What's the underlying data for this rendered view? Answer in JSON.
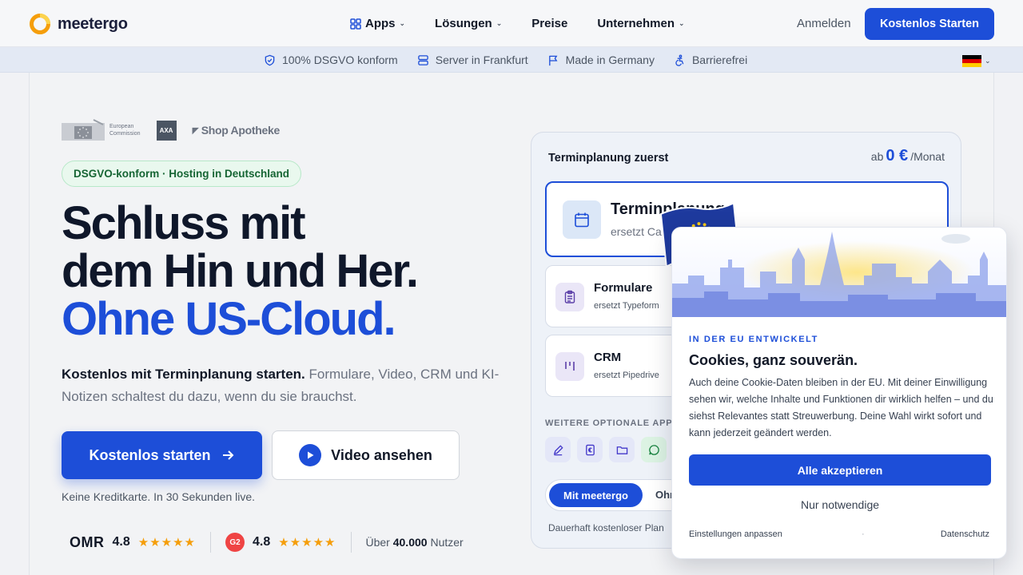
{
  "nav": {
    "logo_text": "meetergo",
    "items": [
      {
        "label": "Apps",
        "has_dropdown": true,
        "icon": "grid-icon"
      },
      {
        "label": "Lösungen",
        "has_dropdown": true
      },
      {
        "label": "Preise",
        "has_dropdown": false
      },
      {
        "label": "Unternehmen",
        "has_dropdown": true
      }
    ],
    "login": "Anmelden",
    "cta": "Kostenlos Starten"
  },
  "trustbar": {
    "items": [
      {
        "label": "100% DSGVO konform",
        "icon": "shield-check-icon"
      },
      {
        "label": "Server in Frankfurt",
        "icon": "server-icon"
      },
      {
        "label": "Made in Germany",
        "icon": "flag-icon"
      },
      {
        "label": "Barrierefrei",
        "icon": "accessibility-icon"
      }
    ],
    "language_flag": "german-flag-icon"
  },
  "hero": {
    "logos": {
      "european_commission_line1": "European",
      "european_commission_line2": "Commission",
      "axa": "AXA",
      "shop_apotheke": "Shop Apotheke"
    },
    "pill": "DSGVO-konform · Hosting in Deutschland",
    "headline_line1": "Schluss mit",
    "headline_line2": "dem Hin und Her.",
    "headline_line3": "Ohne US-Cloud.",
    "lead_bold": "Kostenlos mit Terminplanung starten.",
    "lead_rest": " Formulare, Video, CRM und KI-Notizen schaltest du dazu, wenn du sie brauchst.",
    "primary_button": "Kostenlos starten",
    "secondary_button": "Video ansehen",
    "note": "Keine Kreditkarte. In 30 Sekunden live.",
    "ratings": {
      "omr_label": "OMR",
      "omr_score": "4.8",
      "g2_label": "G2",
      "g2_score": "4.8",
      "stars": "★★★★★",
      "users_prefix": "Über ",
      "users_count": "40.000",
      "users_suffix": " Nutzer"
    }
  },
  "card": {
    "title": "Terminplanung zuerst",
    "price_prefix": "ab",
    "price_value": "0 €",
    "price_suffix": "/Monat",
    "main_app": {
      "title": "Terminplanung",
      "subtitle": "ersetzt Calendly"
    },
    "apps": [
      {
        "title": "Formulare",
        "subtitle": "ersetzt Typeform"
      },
      {
        "title": "CRM",
        "subtitle": "ersetzt Pipedrive"
      }
    ],
    "optional_label": "WEITERE OPTIONALE APPS",
    "optional_icons": [
      "pen-icon",
      "euro-document-icon",
      "folder-icon",
      "chat-icon"
    ],
    "toggle_on": "Mit meetergo",
    "toggle_off": "Ohne",
    "free_plan": "Dauerhaft kostenloser Plan"
  },
  "cookie": {
    "kicker": "IN DER EU ENTWICKELT",
    "title": "Cookies, ganz souverän.",
    "body": "Auch deine Cookie-Daten bleiben in der EU. Mit deiner Einwilligung sehen wir, welche Inhalte und Funktionen dir wirklich helfen – und du siehst Relevantes statt Streuwerbung. Deine Wahl wirkt sofort und kann jederzeit geändert werden.",
    "accept": "Alle akzeptieren",
    "necessary": "Nur notwendige",
    "settings": "Einstellungen anpassen",
    "dot": "·",
    "privacy": "Datenschutz"
  },
  "colors": {
    "brand": "#1d4ed8",
    "text": "#0f172a",
    "muted": "#6b7280",
    "star": "#f59e0b",
    "success": "#166534"
  }
}
